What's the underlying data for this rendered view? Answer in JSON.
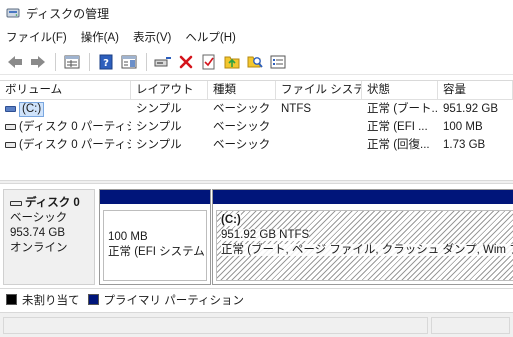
{
  "window": {
    "title": "ディスクの管理"
  },
  "menu": [
    "ファイル(F)",
    "操作(A)",
    "表示(V)",
    "ヘルプ(H)"
  ],
  "toolbar": {
    "icons": [
      "back-arrow-icon",
      "forward-arrow-icon",
      "properties-grid-icon",
      "help-book-icon",
      "panel-view-icon",
      "connect-icon",
      "delete-icon",
      "check-icon",
      "folder-up-icon",
      "search-icon",
      "list-icon"
    ],
    "colors": {
      "delete": "#d4141c",
      "folder": "#f3c72f",
      "help": "#2d5fbd"
    }
  },
  "volumes": {
    "columns": [
      "ボリューム",
      "レイアウト",
      "種類",
      "ファイル システム",
      "状態",
      "容量"
    ],
    "rows": [
      {
        "name": "(C:)",
        "layout": "シンプル",
        "type": "ベーシック",
        "fs": "NTFS",
        "status": "正常 (ブート...",
        "capacity": "951.92 GB",
        "selected": true
      },
      {
        "name": "(ディスク 0 パーティシ...",
        "layout": "シンプル",
        "type": "ベーシック",
        "fs": "",
        "status": "正常 (EFI ...",
        "capacity": "100 MB",
        "selected": false
      },
      {
        "name": "(ディスク 0 パーティシ...",
        "layout": "シンプル",
        "type": "ベーシック",
        "fs": "",
        "status": "正常 (回復...",
        "capacity": "1.73 GB",
        "selected": false
      }
    ]
  },
  "disk": {
    "name": "ディスク 0",
    "type": "ベーシック",
    "size": "953.74 GB",
    "state": "オンライン",
    "partitions": [
      {
        "name": "",
        "size": "100 MB",
        "status": "正常 (EFI システム パ"
      },
      {
        "name": "(C:)",
        "size": "951.92 GB NTFS",
        "status": "正常 (ブート, ページ ファイル, クラッシュ ダンプ, Wim ブート, ベーシ"
      }
    ]
  },
  "legend": [
    {
      "label": "未割り当て",
      "color": "#000000"
    },
    {
      "label": "プライマリ パーティション",
      "color": "#00157a"
    }
  ]
}
